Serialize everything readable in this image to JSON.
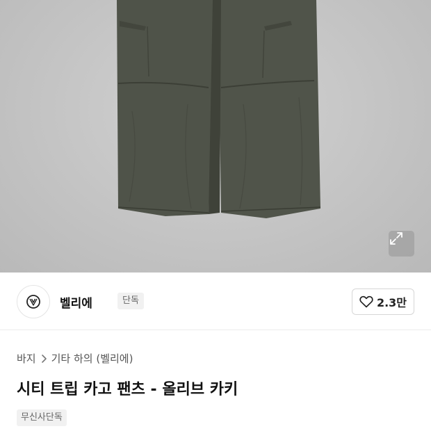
{
  "product_image": {
    "alt": "olive khaki cargo pants",
    "expand_icon": "expand-icon"
  },
  "brand": {
    "logo_icon": "brand-logo-icon",
    "name": "벨리에",
    "badge": "단독"
  },
  "like": {
    "icon": "heart-icon",
    "count": "2.3만"
  },
  "breadcrumb": {
    "items": [
      "바지",
      "기타 하의 (벨리에)"
    ],
    "separator_icon": "chevron-right-icon"
  },
  "product": {
    "title": "시티 트립 카고 팬츠 - 올리브 카키",
    "tag": "무신사단독"
  },
  "colors": {
    "pants": "#4f5349",
    "background": "#c4c4c4"
  }
}
